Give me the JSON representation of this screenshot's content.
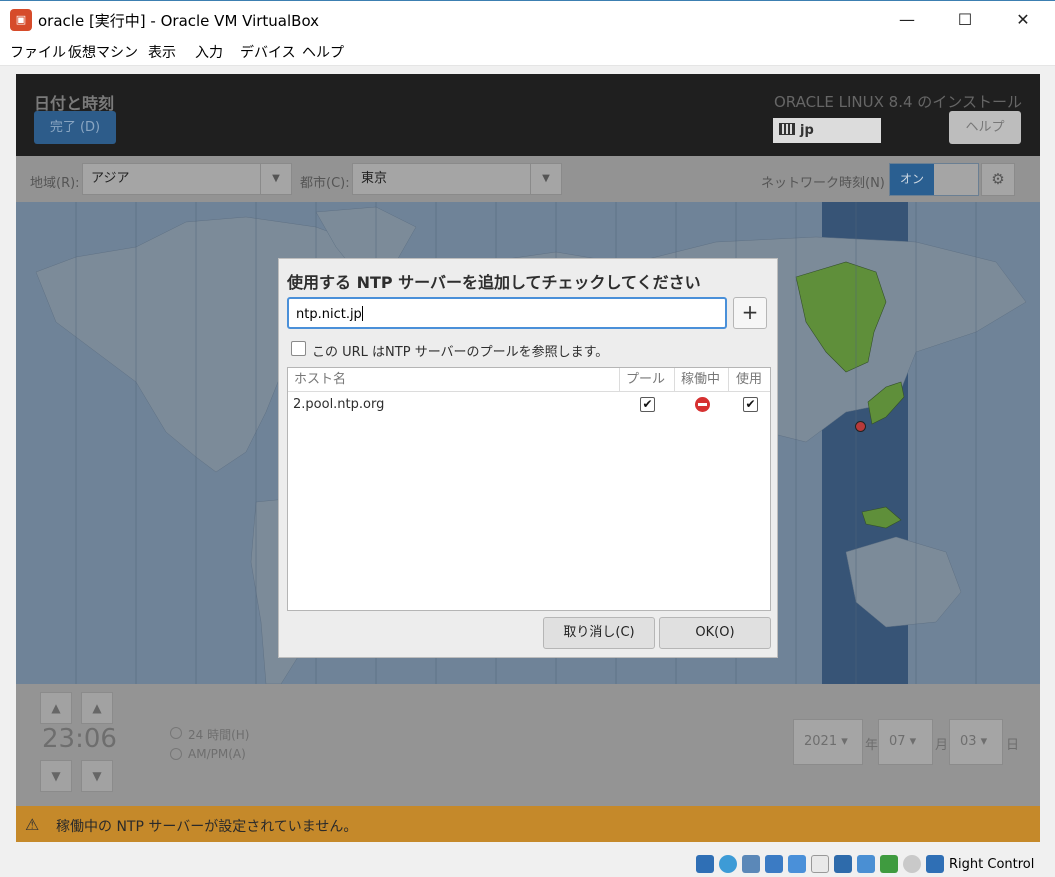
{
  "window": {
    "title": "oracle [実行中] - Oracle VM VirtualBox",
    "app_icon": "virtualbox-icon",
    "minimize": "—",
    "maximize": "☐",
    "close": "✕"
  },
  "menu": [
    "ファイル",
    "仮想マシン",
    "表示",
    "入力",
    "デバイス",
    "ヘルプ"
  ],
  "installer": {
    "page_title": "日付と時刻",
    "done_button": "完了 (D)",
    "product_title": "ORACLE LINUX 8.4 のインストール",
    "keyboard_layout": "jp",
    "help_button": "ヘルプ",
    "region_label": "地域(R):",
    "region_value": "アジア",
    "city_label": "都市(C):",
    "city_value": "東京",
    "network_time_label": "ネットワーク時刻(N)",
    "network_time_toggle": "オン",
    "time": "23:06",
    "format_24h": "24 時間(H)",
    "format_ampm": "AM/PM(A)",
    "year": "2021",
    "year_sep": "年",
    "month": "07",
    "month_sep": "月",
    "day": "03",
    "day_sep": "日",
    "warning_text": "稼働中の NTP サーバーが設定されていません。"
  },
  "dialog": {
    "heading": "使用する NTP サーバーを追加してチェックしてください",
    "input_value": "ntp.nict.jp",
    "add_button": "+",
    "pool_checkbox_label": "この URL はNTP サーバーのプールを参照します。",
    "columns": [
      "ホスト名",
      "プール",
      "稼働中",
      "使用"
    ],
    "rows": [
      {
        "host": "2.pool.ntp.org",
        "pool": true,
        "working": false,
        "use": true
      }
    ],
    "cancel_button": "取り消し(C)",
    "ok_button": "OK(O)"
  },
  "statusbar": {
    "host_key": "Right Control",
    "icons": [
      "hdd-icon",
      "optical-icon",
      "audio-icon",
      "network-icon",
      "usb-icon",
      "shared-folder-icon",
      "display-icon",
      "recording-icon",
      "mouse-integration-icon",
      "cpu-icon",
      "arrow-icon"
    ]
  },
  "colors": {
    "accent": "#2a5f91",
    "warning": "#c5892a",
    "selected_timezone": "#375476"
  }
}
